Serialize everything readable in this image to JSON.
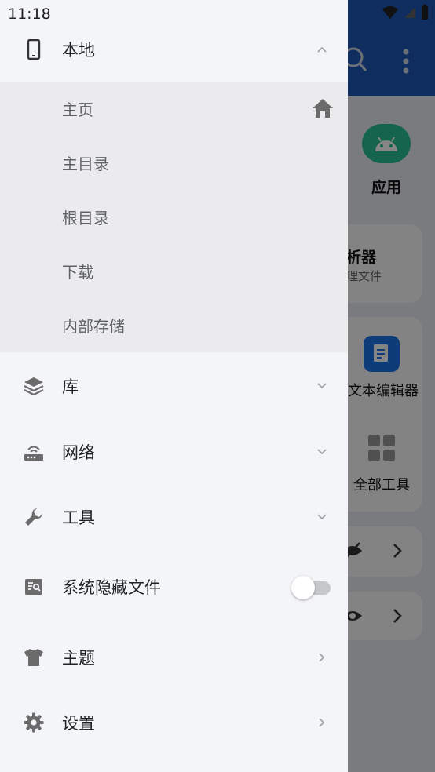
{
  "status_bar": {
    "time": "11:18"
  },
  "background": {
    "apps_label": "应用",
    "analyzer_title": "析器",
    "analyzer_sub": "理文件",
    "text_editor_label": "文本编辑器",
    "all_tools_label": "全部工具"
  },
  "drawer": {
    "local": {
      "label": "本地",
      "sub_items": [
        {
          "label": "主页"
        },
        {
          "label": "主目录"
        },
        {
          "label": "根目录"
        },
        {
          "label": "下载"
        },
        {
          "label": "内部存储"
        }
      ]
    },
    "library": {
      "label": "库"
    },
    "network": {
      "label": "网络"
    },
    "tools": {
      "label": "工具"
    },
    "hidden_files": {
      "label": "系统隐藏文件",
      "enabled": false
    },
    "theme": {
      "label": "主题"
    },
    "settings": {
      "label": "设置"
    }
  },
  "colors": {
    "topbar": "#1d57b5",
    "drawer_bg": "#f4f5f8",
    "sub_panel_bg": "#ebebed",
    "icon_gray": "#6b6b6b"
  }
}
